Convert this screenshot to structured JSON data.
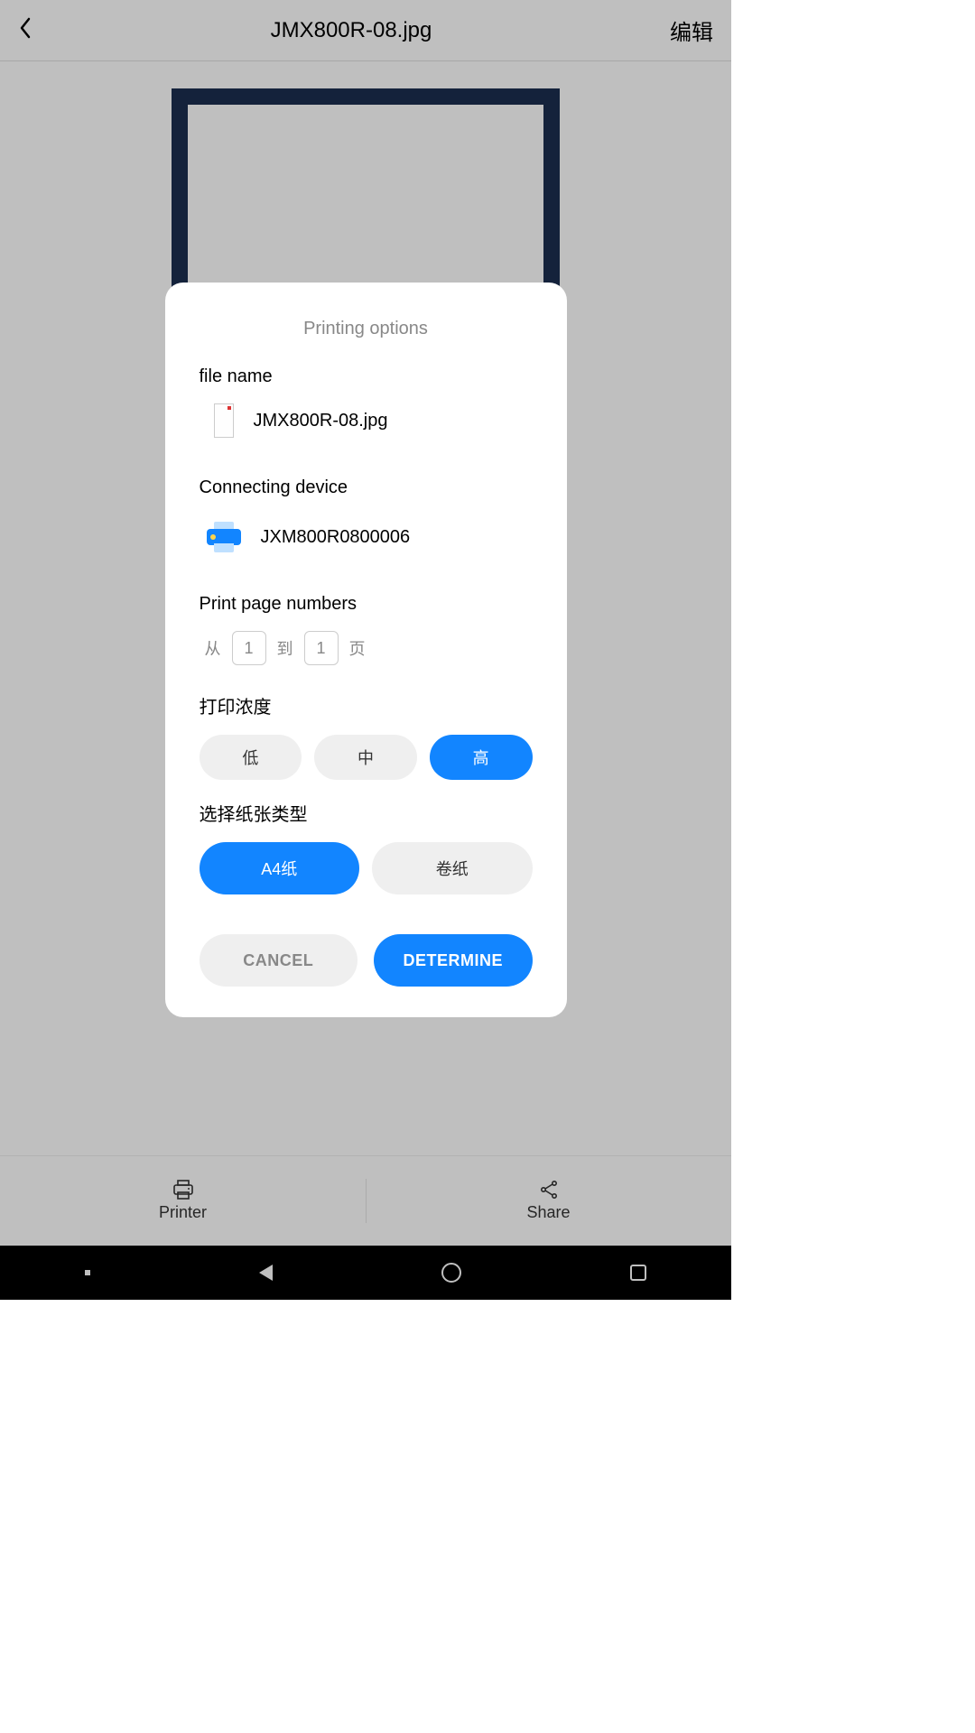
{
  "header": {
    "title": "JMX800R-08.jpg",
    "edit_label": "编辑"
  },
  "bottombar": {
    "printer_label": "Printer",
    "share_label": "Share"
  },
  "dialog": {
    "title": "Printing options",
    "file_label": "file name",
    "file_name": "JMX800R-08.jpg",
    "device_label": "Connecting device",
    "device_name": "JXM800R0800006",
    "page_label": "Print page numbers",
    "page_from_label": "从",
    "page_from_value": "1",
    "page_to_label": "到",
    "page_to_value": "1",
    "page_unit_label": "页",
    "density_label": "打印浓度",
    "density_options": {
      "low": "低",
      "mid": "中",
      "high": "高"
    },
    "paper_label": "选择纸张类型",
    "paper_options": {
      "a4": "A4纸",
      "roll": "卷纸"
    },
    "cancel_label": "CANCEL",
    "ok_label": "DETERMINE"
  }
}
